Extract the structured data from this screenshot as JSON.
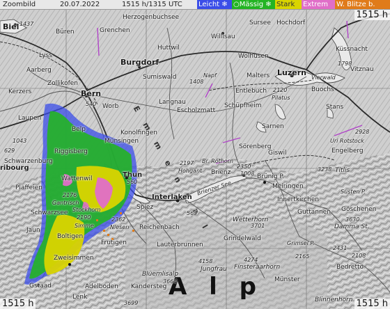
{
  "header": {
    "zoom_label": "Zoombild",
    "date": "20.07.2022",
    "time": "1515 h/1315 UTC",
    "corner_top_right": "1515 h",
    "corner_bottom_left": "1515 h",
    "corner_bottom_right": "1515 h"
  },
  "legend": [
    {
      "label": "Leicht",
      "color": "#3b4ee8"
    },
    {
      "label": "Mässig",
      "color": "#23b423"
    },
    {
      "label": "Stark",
      "color": "#d9d400"
    },
    {
      "label": "Extrem",
      "color": "#e06ec8"
    },
    {
      "label": "W. Blitze",
      "color": "#e07b1a"
    }
  ],
  "legend_suffix": "b.",
  "places": {
    "biel": "Biel",
    "buren": "Büren",
    "grenchen": "Grenchen",
    "herzogen": "Herzogenbuchsee",
    "willisau": "Willisau",
    "sursee": "Sursee",
    "hochdorf": "Hochdorf",
    "lyss": "Lyss",
    "hutwil": "Huttwil",
    "wolhusen": "Wolhusen",
    "kussnacht": "Küssnacht",
    "aarberg": "Aarberg",
    "burgdorf": "Burgdorf",
    "sumiswald": "Sumiswald",
    "malters": "Malters",
    "luzern": "Luzern",
    "zollikofen": "Zollikofen",
    "napf": "Napf",
    "vierwald": "Vierwald",
    "vitznau": "Vitznau",
    "kerzers": "Kerzers",
    "bern": "Bern",
    "entlebuch": "Entlebuch",
    "pilatus": "Pilatus",
    "buochs": "Buochs",
    "langnau": "Langnau",
    "eschholzmatt": "Escholzmatt",
    "schupfheim": "Schüpfheim",
    "stans": "Stans",
    "laupen": "Laupen",
    "worb": "Worb",
    "belp": "Belp",
    "konolfingen": "Konolfingen",
    "sarnen": "Sarnen",
    "munsingen": "Münsingen",
    "riggisberg": "Riggisberg",
    "sorenberg": "Sörenberg",
    "giswil": "Giswil",
    "urirot": "Uri Rotstock",
    "engelberg": "Engelberg",
    "schwarzenburg": "Schwarzenburg",
    "fribourg": "ribourg",
    "thun": "Thun",
    "hohgant": "Hohgant",
    "brienz": "Brienz",
    "rothorn": "Br. Rothorn",
    "brunigp": "Brünig P.",
    "titlis": "Titlis",
    "meiringen": "Meiringen",
    "sustenp": "Susten P.",
    "plaffeien": "Plaffeien",
    "wattenwil": "Wattenwil",
    "interlaken": "Interlaken",
    "innertkirchen": "Innertkirchen",
    "goschenen": "Göschenen",
    "gantrisch": "Gantrisch",
    "spiez": "Spiez",
    "schwarzsee": "Schwarzsee",
    "reichenbach": "Reichenbach",
    "guttannen": "Guttannen",
    "dammast": "Damma St.",
    "jaun": "Jaun",
    "stockhorn": "Stockhorn",
    "niesen": "Niesen",
    "wetterhorn": "Wetterhorn",
    "simme": "Simme",
    "boltigen": "Boltigen",
    "frutigen": "Frutigen",
    "lauterbrunnen": "Lauterbrunnen",
    "grindelwald": "Grindelwald",
    "grimselp": "Grimsel P.",
    "zweisimmen": "Zweisimmen",
    "jungfrau": "Jungfrau",
    "finsteraarhorn": "Finsteraarhorn",
    "bedretto": "Bedretto",
    "bluemlisalp": "Blüemlisalp",
    "adelboden": "Adelboden",
    "kandersteg": "Kandersteg",
    "gstaad": "Gstaad",
    "lenk": "Lenk",
    "munster": "Münster",
    "binnenhorn": "Blinnenhorn",
    "brienzersee": "Brienzer See",
    "emmental": "E m m e n t a l",
    "alpi": "A l p",
    "peaks": {
      "p1437": "1437",
      "p1408": "1408",
      "p1798": "1798",
      "p2120": "2120",
      "p540": "540",
      "p1043": "1043",
      "p2197": "2197",
      "p2350": "2350",
      "p1008": "1008",
      "p3238": "3238",
      "p2928": "2928",
      "p560": "560",
      "p2176": "2176",
      "p2190": "2190",
      "p563": "563",
      "p2362": "2362",
      "p3701": "3701",
      "p3630": "3630",
      "p2165": "2165",
      "p4158": "4158",
      "p4274": "4274",
      "p3664": "3664",
      "p3699": "3699",
      "p2431": "2431",
      "p2108": "2108",
      "p629": "629"
    }
  }
}
